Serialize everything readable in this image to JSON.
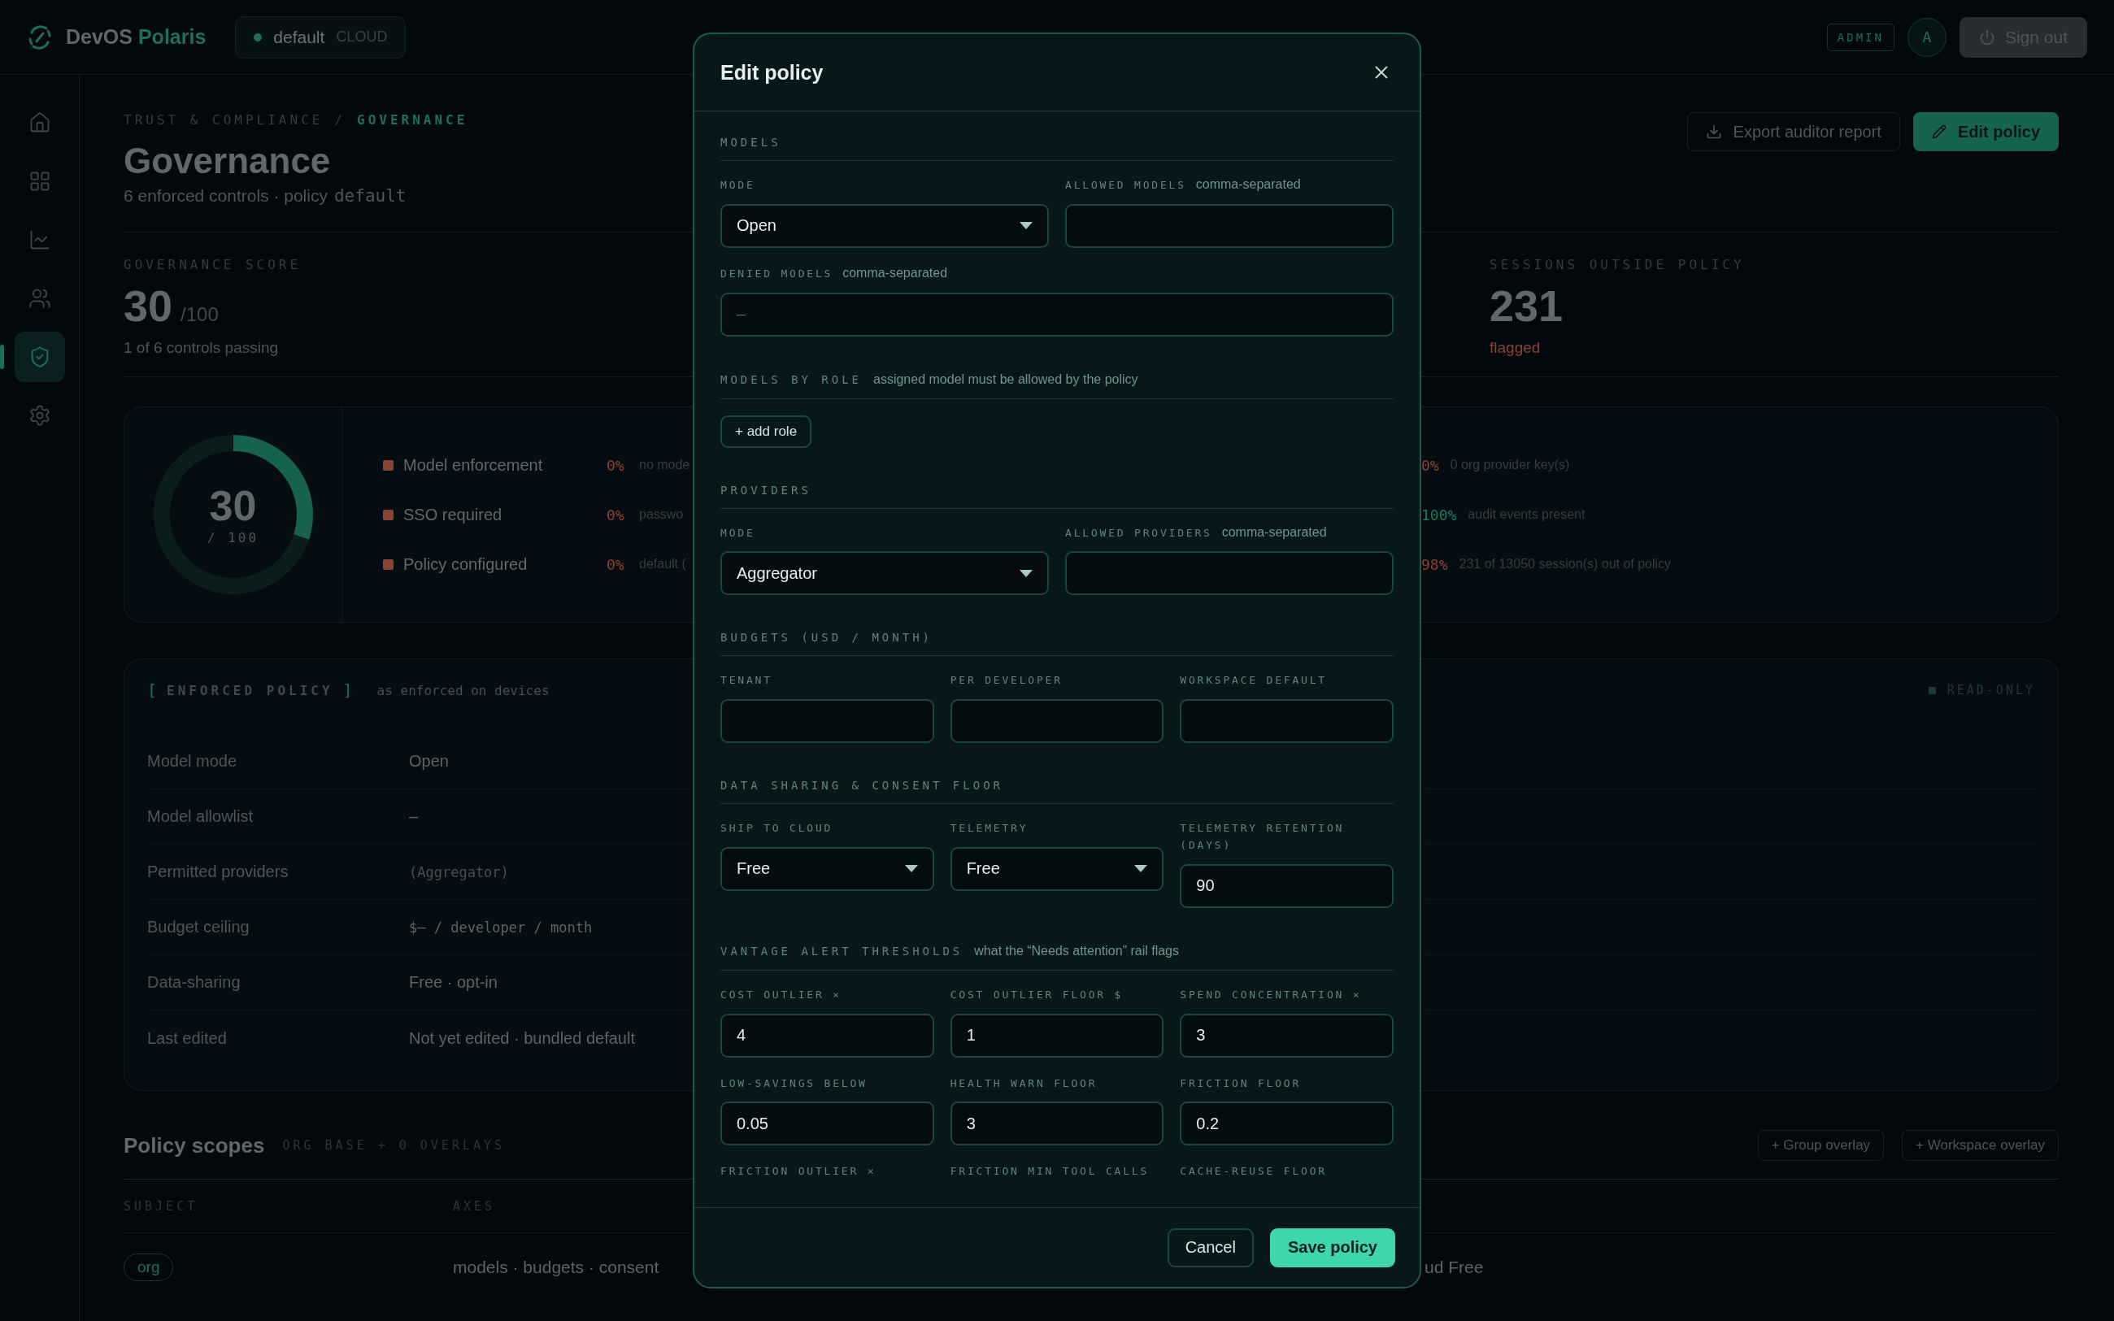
{
  "topbar": {
    "brand": {
      "primary": "DevOS",
      "accent": "Polaris"
    },
    "workspace": {
      "name": "default",
      "tier": "CLOUD"
    },
    "role_badge": "ADMIN",
    "avatar": "A",
    "sign_out": "Sign out"
  },
  "sidebar": {
    "items": [
      {
        "kind": "home",
        "selected": false
      },
      {
        "kind": "grid",
        "selected": false
      },
      {
        "kind": "chart",
        "selected": false
      },
      {
        "kind": "users",
        "selected": false
      },
      {
        "kind": "shield",
        "selected": true
      },
      {
        "kind": "settings",
        "selected": false
      }
    ]
  },
  "header": {
    "breadcrumb": [
      {
        "label": "TRUST & COMPLIANCE",
        "current": false
      },
      {
        "label": "GOVERNANCE",
        "current": true
      }
    ],
    "separator": "/",
    "title": "Governance",
    "subtitle": "6 enforced controls · policy",
    "policy": "default",
    "actions": [
      {
        "label": "Export auditor report",
        "kind": "secondary"
      },
      {
        "label": "Edit policy",
        "kind": "primary"
      }
    ]
  },
  "stats": [
    {
      "label": "GOVERNANCE SCORE",
      "value": "30",
      "suffix": "/100",
      "note": "1 of 6 controls passing",
      "color": "#4c5659"
    },
    {
      "label": "SESSIONS OUTSIDE POLICY",
      "value": "231",
      "note": "flagged",
      "color": "#8a4232"
    }
  ],
  "score_card": {
    "score": "30",
    "max": "/ 100",
    "level": 0.3,
    "controls": [
      {
        "name": "Model enforcement",
        "pct": "0%",
        "detail": "no mode",
        "color": "#8a4232"
      },
      {
        "name": "SSO required",
        "pct": "0%",
        "detail": "passwo",
        "color": "#8a4232"
      },
      {
        "name": "Policy configured",
        "pct": "0%",
        "detail": "default (",
        "color": "#8a4232"
      }
    ],
    "controls_right": [
      {
        "pct": "0%",
        "detail": "0 org provider key(s)",
        "color": "#8a4232"
      },
      {
        "pct": "100%",
        "detail": "audit events present",
        "color": "#1f7a63"
      },
      {
        "pct": "98%",
        "detail": "231 of 13050 session(s) out of policy",
        "color": "#8a4232"
      }
    ]
  },
  "enforced_policy": {
    "brackets": [
      "[",
      "]"
    ],
    "title": "ENFORCED POLICY",
    "subtitle": "as enforced on devices",
    "badge": "READ-ONLY",
    "rows": [
      {
        "label": "Model mode",
        "value": "Open",
        "kind": "text"
      },
      {
        "label": "Model allowlist",
        "value": "–",
        "kind": "text"
      },
      {
        "label": "Permitted providers",
        "value": "(Aggregator)",
        "kind": "muted"
      },
      {
        "label": "Budget ceiling",
        "value": "$– / developer / month",
        "kind": "mono"
      },
      {
        "label": "Data-sharing",
        "value": "Free · opt-in",
        "kind": "text"
      },
      {
        "label": "Last edited",
        "value": "Not yet edited · bundled default",
        "kind": "text"
      }
    ]
  },
  "policy_scopes": {
    "title": "Policy scopes",
    "summary": "ORG BASE + 0 OVERLAYS",
    "actions": [
      "+ Group overlay",
      "+ Workspace overlay"
    ],
    "columns": [
      "SUBJECT",
      "AXES"
    ],
    "rows": [
      {
        "subject": "org",
        "axes": "models · budgets · consent",
        "column_3": "ud Free"
      }
    ]
  },
  "modal": {
    "title": "Edit policy",
    "sections": [
      {
        "title": "MODELS",
        "rows": [
          [
            {
              "kind": "select",
              "label": "MODE",
              "value": "Open"
            },
            {
              "kind": "input",
              "label": "ALLOWED MODELS",
              "hint": "comma-separated"
            }
          ],
          [
            {
              "kind": "input",
              "label": "DENIED MODELS",
              "hint": "comma-separated",
              "placeholder": "–"
            }
          ]
        ]
      },
      {
        "title": "MODELS BY ROLE",
        "hint": "assigned model must be allowed by the policy",
        "action": "+ add role"
      },
      {
        "title": "PROVIDERS",
        "rows": [
          [
            {
              "kind": "select",
              "label": "MODE",
              "value": "Aggregator"
            },
            {
              "kind": "input",
              "label": "ALLOWED PROVIDERS",
              "hint": "comma-separated"
            }
          ]
        ]
      },
      {
        "title": "BUDGETS (USD / MONTH)",
        "rows": [
          [
            {
              "kind": "input",
              "label": "TENANT"
            },
            {
              "kind": "input",
              "label": "PER DEVELOPER"
            },
            {
              "kind": "input",
              "label": "WORKSPACE DEFAULT"
            }
          ]
        ]
      },
      {
        "title": "DATA SHARING & CONSENT FLOOR",
        "rows": [
          [
            {
              "kind": "select",
              "label": "SHIP TO CLOUD",
              "value": "Free"
            },
            {
              "kind": "select",
              "label": "TELEMETRY",
              "value": "Free"
            },
            {
              "kind": "input",
              "label": "TELEMETRY RETENTION (DAYS)",
              "value": "90"
            }
          ]
        ]
      },
      {
        "title": "VANTAGE ALERT THRESHOLDS",
        "hint": "what the “Needs attention” rail flags",
        "rows": [
          [
            {
              "kind": "input",
              "label": "COST OUTLIER ×",
              "value": "4"
            },
            {
              "kind": "input",
              "label": "COST OUTLIER FLOOR $",
              "value": "1"
            },
            {
              "kind": "input",
              "label": "SPEND CONCENTRATION ×",
              "value": "3"
            }
          ],
          [
            {
              "kind": "input",
              "label": "LOW-SAVINGS BELOW",
              "value": "0.05"
            },
            {
              "kind": "input",
              "label": "HEALTH WARN FLOOR",
              "value": "3"
            },
            {
              "kind": "input",
              "label": "FRICTION FLOOR",
              "value": "0.2"
            }
          ],
          [
            {
              "kind": "label",
              "label": "FRICTION OUTLIER ×"
            },
            {
              "kind": "label",
              "label": "FRICTION MIN TOOL CALLS"
            },
            {
              "kind": "label",
              "label": "CACHE-REUSE FLOOR"
            }
          ]
        ]
      }
    ],
    "buttons": [
      {
        "label": "Cancel",
        "kind": "secondary"
      },
      {
        "label": "Save policy",
        "kind": "primary"
      }
    ]
  }
}
